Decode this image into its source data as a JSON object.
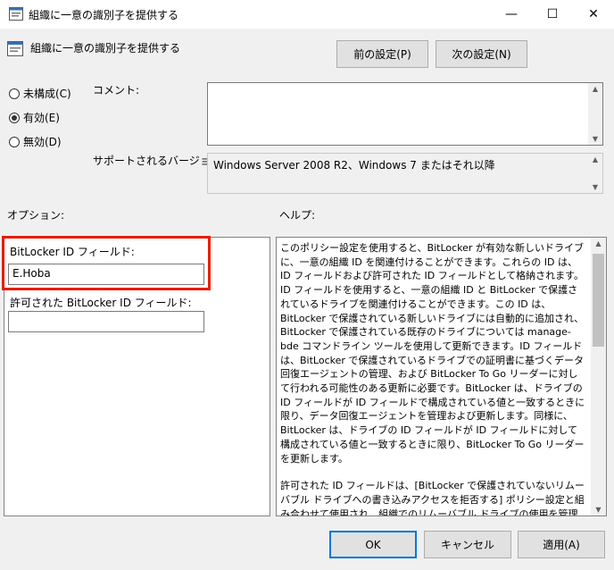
{
  "window": {
    "title": "組織に一意の識別子を提供する",
    "minimize": "—",
    "maximize": "☐",
    "close": "✕"
  },
  "header": {
    "title": "組織に一意の識別子を提供する",
    "prev_button": "前の設定(P)",
    "next_button": "次の設定(N)"
  },
  "state": {
    "options": [
      {
        "label": "未構成(C)",
        "selected": false
      },
      {
        "label": "有効(E)",
        "selected": true
      },
      {
        "label": "無効(D)",
        "selected": false
      }
    ]
  },
  "comment": {
    "label": "コメント:",
    "value": ""
  },
  "supported": {
    "label": "サポートされるバージョン:",
    "value": "Windows Server 2008 R2、Windows 7 またはそれ以降"
  },
  "options_label": "オプション:",
  "help_label": "ヘルプ:",
  "fields": {
    "id_label": "BitLocker ID フィールド:",
    "id_value": "E.Hoba",
    "allowed_label": "許可された BitLocker ID フィールド:",
    "allowed_value": ""
  },
  "help": {
    "p1": "このポリシー設定を使用すると、BitLocker が有効な新しいドライブに、一意の組織 ID を関連付けることができます。これらの ID は、ID フィールドおよび許可された ID フィールドとして格納されます。ID フィールドを使用すると、一意の組織 ID と BitLocker で保護されているドライブを関連付けることができます。この ID は、BitLocker で保護されている新しいドライブには自動的に追加され、BitLocker で保護されている既存のドライブについては manage-bde コマンドライン ツールを使用して更新できます。ID フィールドは、BitLocker で保護されているドライブでの証明書に基づくデータ回復エージェントの管理、および BitLocker To Go リーダーに対して行われる可能性のある更新に必要です。BitLocker は、ドライブの ID フィールドが ID フィールドで構成されている値と一致するときに限り、データ回復エージェントを管理および更新します。同様に、BitLocker は、ドライブの ID フィールドが ID フィールドに対して構成されている値と一致するときに限り、BitLocker To Go リーダーを更新します。",
    "p2": "許可された ID フィールドは、[BitLocker で保護されていないリムーバブル ドライブへの書き込みアクセスを拒否する] ポリシー設定と組み合わせて使用され、組織でのリムーバブル ドライブの使用を管理するのに役立ちます。許可された ID フィールドは、自分の組織または他の外部組織からの ID フィールドのコンマ区切りの一覧です。"
  },
  "footer": {
    "ok": "OK",
    "cancel": "キャンセル",
    "apply": "適用(A)"
  }
}
